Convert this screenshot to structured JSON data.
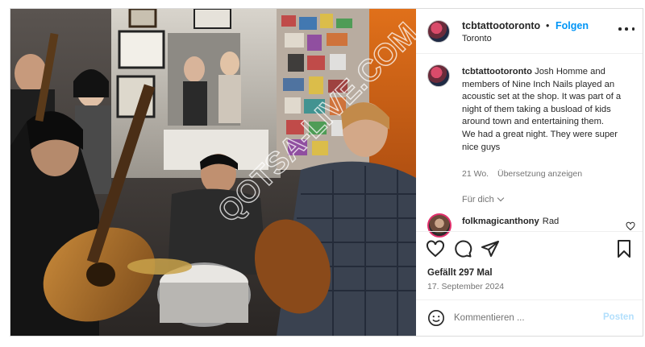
{
  "post": {
    "username": "tcbtattootoronto",
    "follow_label": "Folgen",
    "separator": "•",
    "location": "Toronto",
    "more_icon": "more-horizontal-icon"
  },
  "caption": {
    "username": "tcbtattootoronto",
    "text_line1": "Josh Homme and members of Nine Inch Nails played an acoustic set at the shop. It was part of a night of them taking a busload of kids around town and entertaining them.",
    "text_line2": "We had a great night. They were super nice guys",
    "age": "21 Wo.",
    "translate_label": "Übersetzung anzeigen"
  },
  "for_you": {
    "label": "Für dich"
  },
  "comment": {
    "username": "folkmagicanthony",
    "text": "Rad"
  },
  "actions": {
    "like_icon": "heart-icon",
    "comment_icon": "comment-icon",
    "share_icon": "send-icon",
    "save_icon": "bookmark-icon"
  },
  "stats": {
    "likes": "Gefällt 297 Mal",
    "date": "17. September 2024"
  },
  "comment_bar": {
    "placeholder": "Kommentieren ...",
    "post_label": "Posten"
  },
  "photo": {
    "watermark": "QOTSA-LIVE.COM"
  },
  "colors": {
    "accent": "#0095f6",
    "post_disabled": "#b2dffc",
    "secondary_text": "#737373"
  }
}
